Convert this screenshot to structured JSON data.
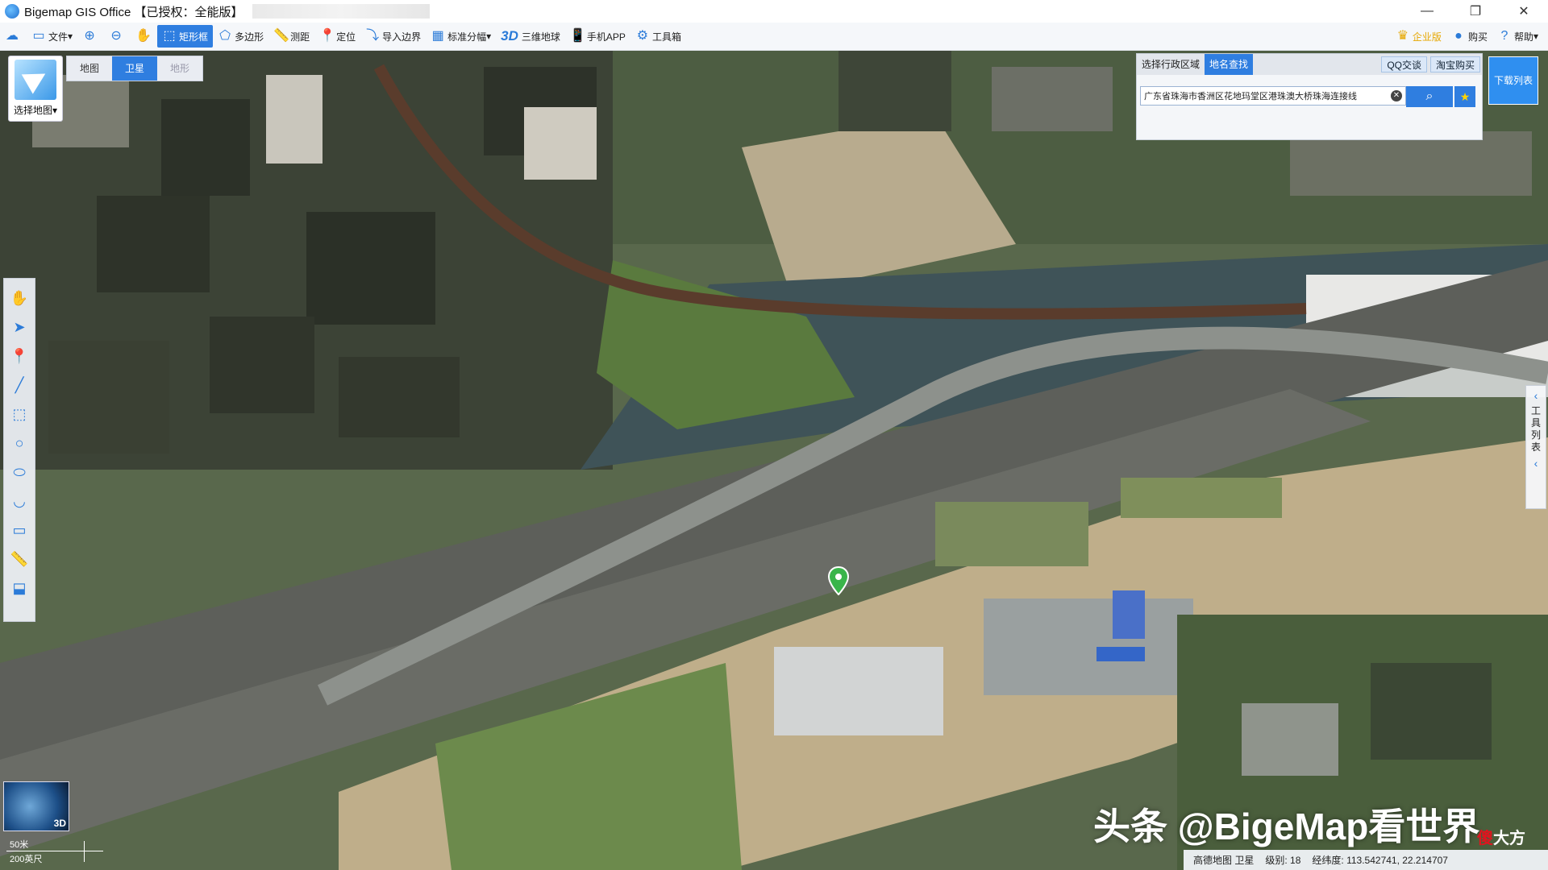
{
  "window": {
    "title": "Bigemap GIS Office 【已授权：全能版】",
    "controls": [
      "—",
      "❐",
      "✕"
    ]
  },
  "toolbar": {
    "items": [
      {
        "icon": "folder-icon",
        "label": "文件"
      },
      {
        "icon": "zoom-in-icon",
        "label": ""
      },
      {
        "icon": "zoom-out-icon",
        "label": ""
      },
      {
        "icon": "hand-icon",
        "label": ""
      },
      {
        "icon": "rectangle-select-icon",
        "label": "矩形框"
      },
      {
        "icon": "polygon-icon",
        "label": "多边形"
      },
      {
        "icon": "ruler-icon",
        "label": "测距"
      },
      {
        "icon": "location-pin-icon",
        "label": "定位"
      },
      {
        "icon": "import-boundary-icon",
        "label": "导入边界"
      },
      {
        "icon": "grid-icon",
        "label": "标准分幅"
      },
      {
        "icon": "3d-icon",
        "label": "三维地球",
        "prefix": "3D"
      },
      {
        "icon": "phone-icon",
        "label": "手机APP"
      },
      {
        "icon": "gear-icon",
        "label": "工具箱"
      }
    ],
    "right": {
      "enterprise": "企业版",
      "buy": "购买",
      "help": "帮助"
    }
  },
  "map_panel": {
    "select_label": "选择地图",
    "tabs": [
      "地图",
      "卫星",
      "地形"
    ],
    "selected_tab": "卫星"
  },
  "search": {
    "tabs": [
      "选择行政区域",
      "地名查找"
    ],
    "selected_tab": "地名查找",
    "qq_button": "QQ交谈",
    "taobao_button": "淘宝购买",
    "query": "广东省珠海市香洲区花地玛堂区港珠澳大桥珠海连接线"
  },
  "download_list": "下载列表",
  "right_drawer": {
    "label": "工具列表"
  },
  "scale": {
    "metric": "50米",
    "imperial": "200英尺"
  },
  "watermark": {
    "main": "头条 @BigeMap看世界",
    "corner_a": "傻",
    "corner_b": "大方"
  },
  "status": {
    "source": "高德地图 卫星",
    "zoom_label": "级别:",
    "zoom": "18",
    "coord_label": "经纬度:",
    "coords": "113.542741, 22.214707"
  },
  "globe_label": "3D",
  "colors": {
    "accent": "#2f7ee0",
    "pin": "#3ab54a"
  }
}
